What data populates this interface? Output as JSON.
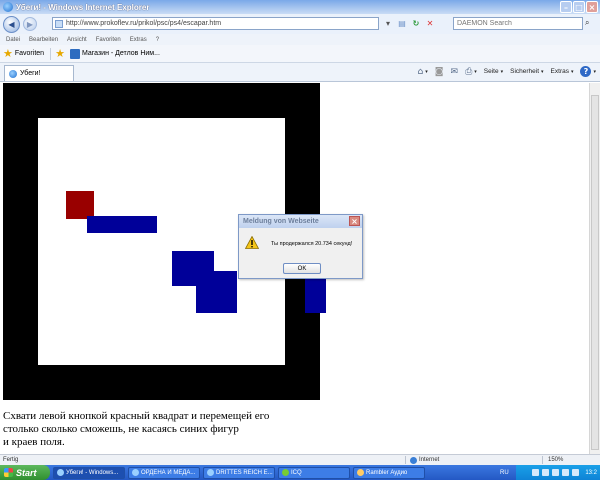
{
  "window": {
    "title": "Убеги! - Windows Internet Explorer"
  },
  "addressbar": {
    "url": "http://www.prokoflev.ru/prikol/psc/ps4/escapar.htm",
    "search_placeholder": "DAEMON Search"
  },
  "menu": [
    "Datei",
    "Bearbeiten",
    "Ansicht",
    "Favoriten",
    "Extras",
    "?"
  ],
  "favorites": {
    "label": "Favoriten",
    "items": [
      "Магазин - Детлов Ним..."
    ]
  },
  "tabs": [
    {
      "label": "Убеги!"
    }
  ],
  "commandbar": {
    "page": "Seite",
    "security": "Sicherheit",
    "tools": "Extras"
  },
  "page": {
    "instructions": [
      "Схвати левой кнопкой красный квадрат и перемещей его",
      "столько сколько сможешь, не касаясь синих фигур",
      "и краев поля."
    ]
  },
  "dialog": {
    "title": "Meldung von Webseite",
    "message": "Ты продержался 20.734 секунд!",
    "ok_label": "OK"
  },
  "status": {
    "text": "Fertig",
    "zone": "Internet",
    "zoom": "150%"
  },
  "taskbar": {
    "start_label": "Start",
    "tasks": [
      {
        "label": "Убеги! - Windows..."
      },
      {
        "label": "ОРДЕНА И МЕДА..."
      },
      {
        "label": "DRITTES REICH E..."
      },
      {
        "label": "ICQ"
      },
      {
        "label": "Rambler Аудио"
      }
    ],
    "language": "RU",
    "clock": "13:2"
  },
  "colors": {
    "red_square": "#990000",
    "blue_obstacle": "#000099",
    "board_border": "#000000"
  }
}
